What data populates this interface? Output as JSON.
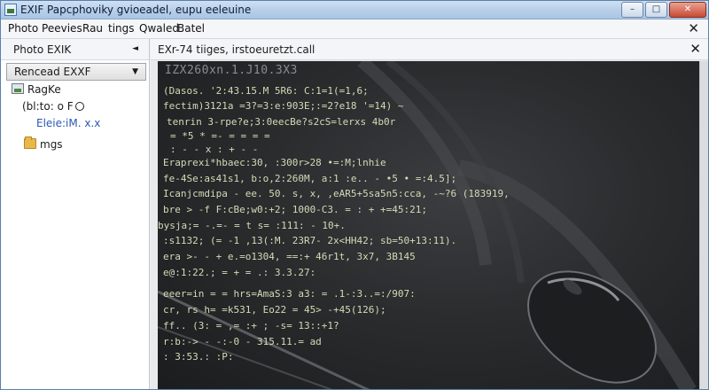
{
  "window": {
    "title": "EXIF Papcphoviky gvioeadel, eupu eeleuine",
    "minimize_glyph": "–",
    "maximize_glyph": "□",
    "close_glyph": "✕"
  },
  "menubar": {
    "items": [
      "Photo Peevies",
      "Rau",
      "tings",
      "Qwaled",
      "Batel"
    ],
    "close_glyph": "✕"
  },
  "sidebar": {
    "header_label": "Photo EXIK",
    "header_arrow": "◄",
    "dropdown_label": "Rencead EXXF",
    "dropdown_arrow": "▼",
    "items": [
      {
        "icon": "image-icon",
        "label": "RagKe"
      },
      {
        "icon": "",
        "label": "(bl:to: o F"
      },
      {
        "icon": "",
        "label": "Eleie:iM. x.x"
      },
      {
        "icon": "folder-icon",
        "label": "mgs"
      }
    ]
  },
  "main": {
    "header_label": "EXr-74 tiiges, irstoeuretzt.call",
    "close_glyph": "✕",
    "photo_title": "IZX260xn.1.J10.3X3",
    "code_lines": [
      "(Dasos. '2:43.15.M  5R6: C:1=1(=1,6;",
      "fectim)3121a =3?=3:e:903E;:=2?e18 '=14) ~",
      "tenrin 3-rpe?e;3:0eecBe?s2cS=lerxs 4b0r",
      "  =  *5 *  =- =  =  =  =",
      "  :  -  -  x  :  +  -  -",
      "  Eraprexi*hbaec:30, :300r>28 •=:M;lnhie",
      "  fe-4Se:as41s1, b:o,2:260M, a:1 :e.. -  •5 • =:4.5];",
      "  Icanjcmdipa - ee. 50.  s, x,  ,eAR5+5sa5n5:cca, -~?6 (183919,",
      "  bre >  -f F:cBe;w0:+2;  1000-C3. = :  + +=45:21;",
      "bysja;=  -.=- =  t s= :111: - 10+.",
      "  :s1132; (= -1 ,13(:M. 23R7- 2x<HH42; sb=50+13:11).",
      "  era >- - + e.=o1304, ==:+ 46r1t, 3x7, 3B145",
      "  e@:1:22.; = +  = .: 3.3.27:",
      "  eeer=in =  =  hrs=AmaS:3 a3:  = .1-:3..=:/907:",
      "  cr,  rs  h= =k531, Eo22 = 45>  -+45(126);",
      "  ff.. (3: = ,= :+ ; -s= 13::+1?",
      "  r:b:-> -  -:-0   -  315.11.= ad",
      "  :  3:53.: :P:"
    ]
  },
  "colors": {
    "titlebar": "#b9d0ea",
    "link": "#2a58b8",
    "code_text": "#d7d9b6",
    "photo_bg": "#2a2c2e"
  }
}
